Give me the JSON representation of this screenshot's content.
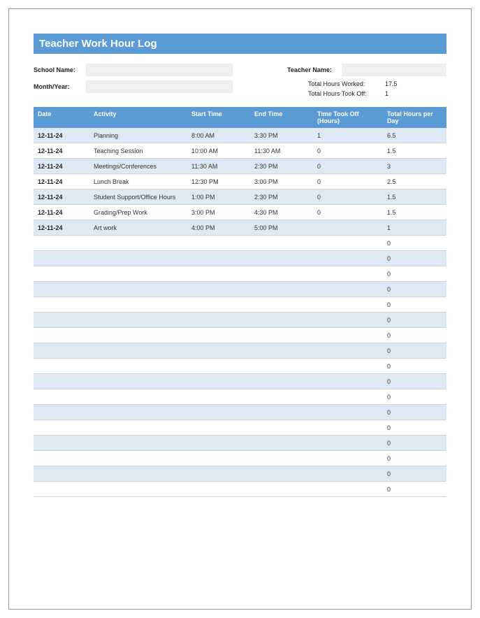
{
  "title": "Teacher Work Hour Log",
  "form": {
    "school_name_label": "School Name:",
    "school_name_value": "",
    "month_year_label": "Month/Year:",
    "month_year_value": "",
    "teacher_name_label": "Teacher Name:",
    "teacher_name_value": "",
    "total_hours_worked_label": "Total Hours Worked:",
    "total_hours_worked_value": "17.5",
    "total_hours_off_label": "Total Hours Took Off:",
    "total_hours_off_value": "1"
  },
  "columns": {
    "date": "Date",
    "activity": "Activity",
    "start": "Start Time",
    "end": "End Time",
    "took": "Time Took Off (Hours)",
    "total": "Total Hours per Day"
  },
  "rows": [
    {
      "date": "12-11-24",
      "activity": "Planning",
      "start": "8:00 AM",
      "end": "3:30 PM",
      "took": "1",
      "total": "6.5"
    },
    {
      "date": "12-11-24",
      "activity": "Teaching Session",
      "start": "10:00 AM",
      "end": "11:30 AM",
      "took": "0",
      "total": "1.5"
    },
    {
      "date": "12-11-24",
      "activity": "Meetings/Conferences",
      "start": "11:30 AM",
      "end": "2:30 PM",
      "took": "0",
      "total": "3"
    },
    {
      "date": "12-11-24",
      "activity": "Lunch Break",
      "start": "12:30 PM",
      "end": "3:00 PM",
      "took": "0",
      "total": "2.5"
    },
    {
      "date": "12-11-24",
      "activity": "Student Support/Office Hours",
      "start": "1:00 PM",
      "end": "2:30 PM",
      "took": "0",
      "total": "1.5"
    },
    {
      "date": "12-11-24",
      "activity": "Grading/Prep Work",
      "start": "3:00 PM",
      "end": "4:30 PM",
      "took": "0",
      "total": "1.5"
    },
    {
      "date": "12-11-24",
      "activity": "Art work",
      "start": "4:00 PM",
      "end": "5:00 PM",
      "took": "",
      "total": "1"
    },
    {
      "date": "",
      "activity": "",
      "start": "",
      "end": "",
      "took": "",
      "total": "0"
    },
    {
      "date": "",
      "activity": "",
      "start": "",
      "end": "",
      "took": "",
      "total": "0"
    },
    {
      "date": "",
      "activity": "",
      "start": "",
      "end": "",
      "took": "",
      "total": "0"
    },
    {
      "date": "",
      "activity": "",
      "start": "",
      "end": "",
      "took": "",
      "total": "0"
    },
    {
      "date": "",
      "activity": "",
      "start": "",
      "end": "",
      "took": "",
      "total": "0"
    },
    {
      "date": "",
      "activity": "",
      "start": "",
      "end": "",
      "took": "",
      "total": "0"
    },
    {
      "date": "",
      "activity": "",
      "start": "",
      "end": "",
      "took": "",
      "total": "0"
    },
    {
      "date": "",
      "activity": "",
      "start": "",
      "end": "",
      "took": "",
      "total": "0"
    },
    {
      "date": "",
      "activity": "",
      "start": "",
      "end": "",
      "took": "",
      "total": "0"
    },
    {
      "date": "",
      "activity": "",
      "start": "",
      "end": "",
      "took": "",
      "total": "0"
    },
    {
      "date": "",
      "activity": "",
      "start": "",
      "end": "",
      "took": "",
      "total": "0"
    },
    {
      "date": "",
      "activity": "",
      "start": "",
      "end": "",
      "took": "",
      "total": "0"
    },
    {
      "date": "",
      "activity": "",
      "start": "",
      "end": "",
      "took": "",
      "total": "0"
    },
    {
      "date": "",
      "activity": "",
      "start": "",
      "end": "",
      "took": "",
      "total": "0"
    },
    {
      "date": "",
      "activity": "",
      "start": "",
      "end": "",
      "took": "",
      "total": "0"
    },
    {
      "date": "",
      "activity": "",
      "start": "",
      "end": "",
      "took": "",
      "total": "0"
    },
    {
      "date": "",
      "activity": "",
      "start": "",
      "end": "",
      "took": "",
      "total": "0"
    }
  ]
}
